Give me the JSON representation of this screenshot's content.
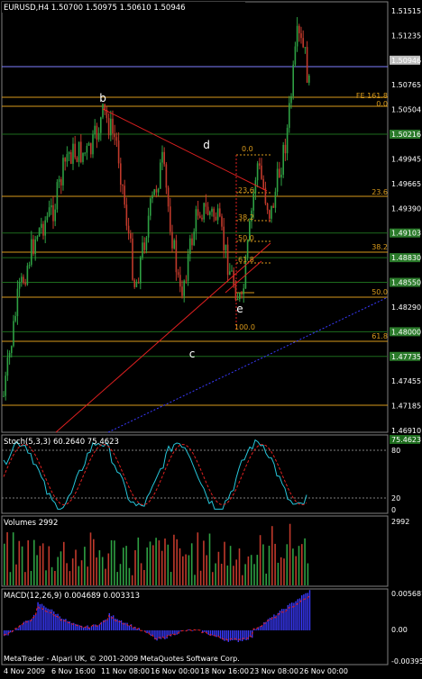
{
  "main_chart": {
    "header": "EURUSD,H4  1.50700 1.50975 1.50610 1.50946",
    "price_ticks": [
      "1.51515",
      "1.51235",
      "1.50946",
      "1.50765",
      "1.50504",
      "1.50216",
      "1.49945",
      "1.49665",
      "1.49390",
      "1.49103",
      "1.48830",
      "1.48550",
      "1.48290",
      "1.48000",
      "1.47735",
      "1.47455",
      "1.47185",
      "1.46910"
    ],
    "highlighted_ticks": {
      "1.50946": "#c0c0c0",
      "1.50216": "#2a7a2a",
      "1.49103": "#2a7a2a",
      "1.48830": "#2a7a2a",
      "1.48550": "#2a7a2a",
      "1.48000": "#2a7a2a",
      "1.47735": "#2a7a2a"
    },
    "wave_labels": [
      "b",
      "d",
      "e",
      "c"
    ],
    "fe_label": "FE 161.8",
    "fib_levels_right": [
      "0.0",
      "23.6",
      "38.2",
      "50.0",
      "61.8"
    ],
    "fib_levels_inner": [
      "0.0",
      "23.6",
      "38.2",
      "50.0",
      "61.8",
      "100.0"
    ],
    "colors": {
      "bull": "#2ea043",
      "bear": "#c0392b",
      "fib": "#d99a1b",
      "trend": "#e02020",
      "support": "#1d6b1d",
      "dotted": "#3a3aff"
    }
  },
  "stoch_pane": {
    "title": "Stoch(5,3,3) 60.2640 75.4623",
    "ticks": [
      "80",
      "20",
      "0"
    ],
    "top_value": "100",
    "badge": "75.4623"
  },
  "volume_pane": {
    "title": "Volumes 2992",
    "ticks": [
      "2992"
    ]
  },
  "macd_pane": {
    "title": "MACD(12,26,9) 0.004689 0.003313",
    "ticks": [
      "0.005687",
      "0.00",
      "-0.003955"
    ],
    "copyright": "MetaTrader - Alpari UK, © 2001-2009 MetaQuotes Software Corp."
  },
  "time_axis": [
    "4 Nov 2009",
    "6 Nov 16:00",
    "11 Nov 08:00",
    "16 Nov 00:00",
    "18 Nov 16:00",
    "23 Nov 08:00",
    "26 Nov 00:00"
  ]
}
